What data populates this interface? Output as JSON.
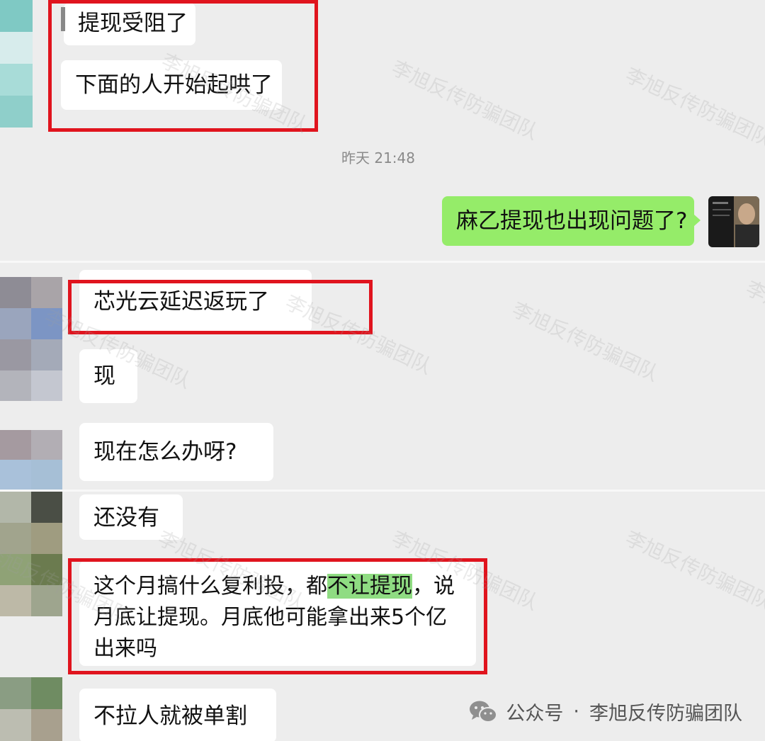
{
  "panel1": {
    "messages": [
      {
        "text": "提现受阻了"
      },
      {
        "text": "下面的人开始起哄了"
      }
    ],
    "timestamp": "昨天 21:48",
    "my_message": "麻乙提现也出现问题了?"
  },
  "panel2": {
    "messages": [
      {
        "text": "芯光云延迟返玩了"
      },
      {
        "text": "现"
      },
      {
        "text": "现在怎么办呀?"
      }
    ]
  },
  "panel3": {
    "messages": [
      {
        "text": "还没有"
      },
      {
        "text_before": "这个月搞什么复利投，都",
        "highlight": "不让提现",
        "text_after": "，说月底让提现。月底他可能拿出来5个亿出来吗"
      },
      {
        "text": "不拉人就被单割"
      }
    ]
  },
  "watermark": "李旭反传防骗团队",
  "footer": {
    "icon": "wechat-icon",
    "label": "公众号",
    "separator": "·",
    "account": "李旭反传防骗团队"
  },
  "colors": {
    "background": "#ededed",
    "bubble_incoming": "#ffffff",
    "bubble_outgoing": "#95ec69",
    "highlight_box": "#e0141e",
    "text_highlight": "#8fdc82"
  }
}
